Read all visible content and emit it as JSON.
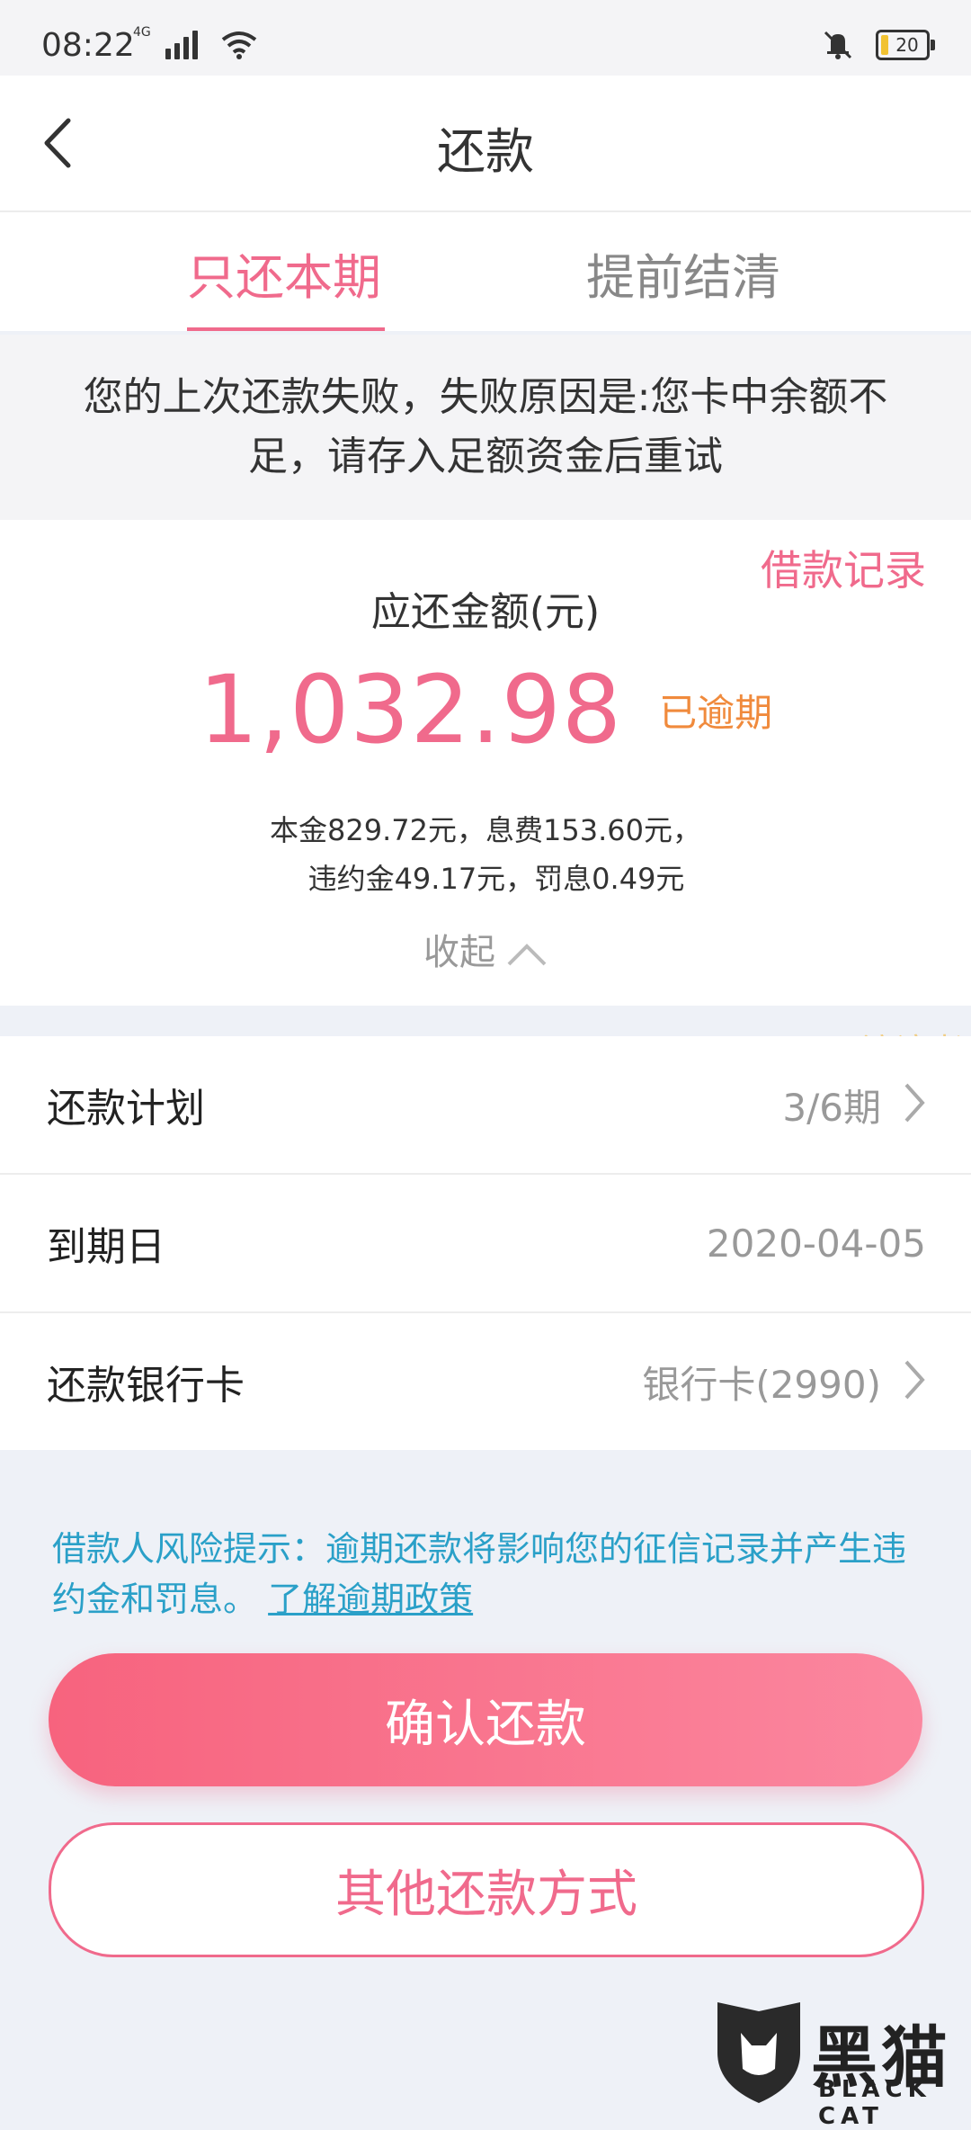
{
  "status_bar": {
    "time": "08:22",
    "network": "4G",
    "battery": "20"
  },
  "nav": {
    "title": "还款"
  },
  "tabs": [
    {
      "label": "只还本期"
    },
    {
      "label": "提前结清"
    }
  ],
  "notice": {
    "text": "您的上次还款失败，失败原因是:您卡中余额不足，请存入足额资金后重试"
  },
  "amount_card": {
    "loan_record_link": "借款记录",
    "label": "应还金额(元)",
    "amount": "1,032.98",
    "status": "已逾期",
    "breakdown_line1": "本金829.72元，息费153.60元，",
    "breakdown_line2": "违约金49.17元，罚息0.49元",
    "collapse_label": "收起"
  },
  "watermark_text": "流浪者",
  "rows": [
    {
      "label": "还款计划",
      "value": "3/6期"
    },
    {
      "label": "到期日",
      "value": "2020-04-05"
    },
    {
      "label": "还款银行卡",
      "value": "银行卡(2990)"
    }
  ],
  "risk": {
    "text": "借款人风险提示：逾期还款将影响您的征信记录并产生违约金和罚息。",
    "link": "了解逾期政策"
  },
  "buttons": {
    "confirm": "确认还款",
    "other": "其他还款方式"
  },
  "logo": {
    "text": "黑猫",
    "sub": "BLACK CAT"
  },
  "colors": {
    "accent": "#f06a8c",
    "overdue": "#f08a3c",
    "link": "#2aa0c8"
  },
  "icons": [
    "back-icon",
    "signal-icon",
    "wifi-icon",
    "mute-icon",
    "battery-icon",
    "chevron-up-icon",
    "chevron-right-icon"
  ]
}
